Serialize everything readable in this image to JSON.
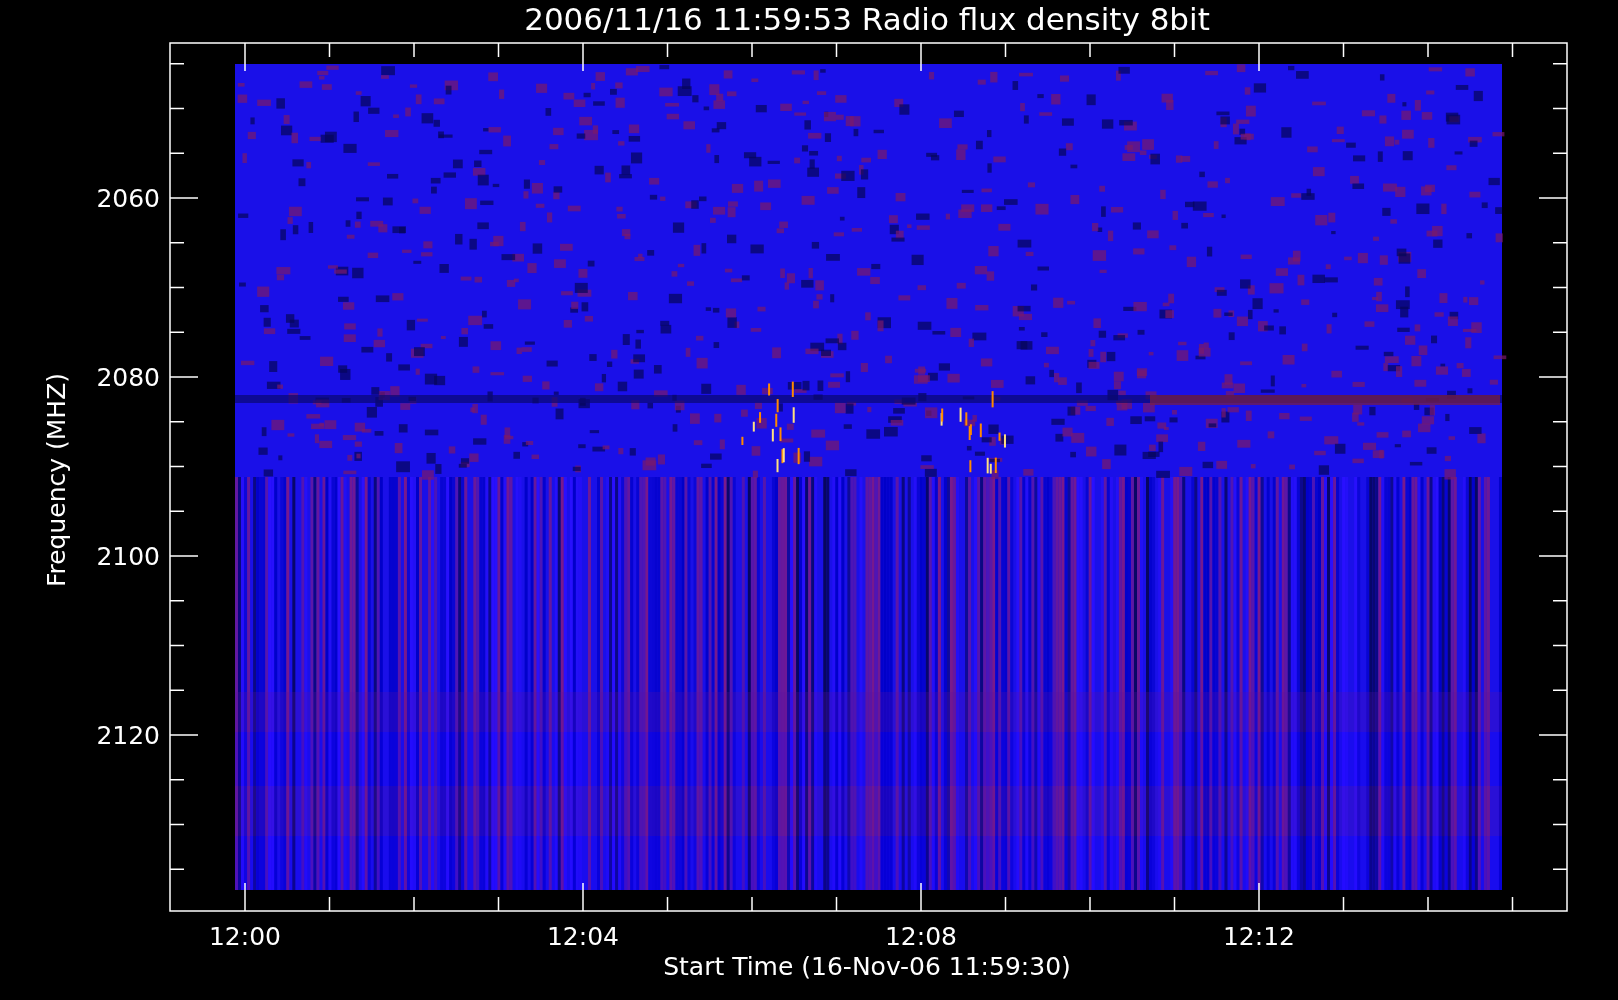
{
  "title": "2006/11/16 11:59:53 Radio flux density 8bit",
  "y_axis": {
    "label": "Frequency (MHZ)",
    "ticks": [
      "2060",
      "2080",
      "2100",
      "2120"
    ]
  },
  "x_axis": {
    "label": "Start Time (16-Nov-06 11:59:30)",
    "ticks": [
      "12:00",
      "12:04",
      "12:08",
      "12:12"
    ]
  }
}
